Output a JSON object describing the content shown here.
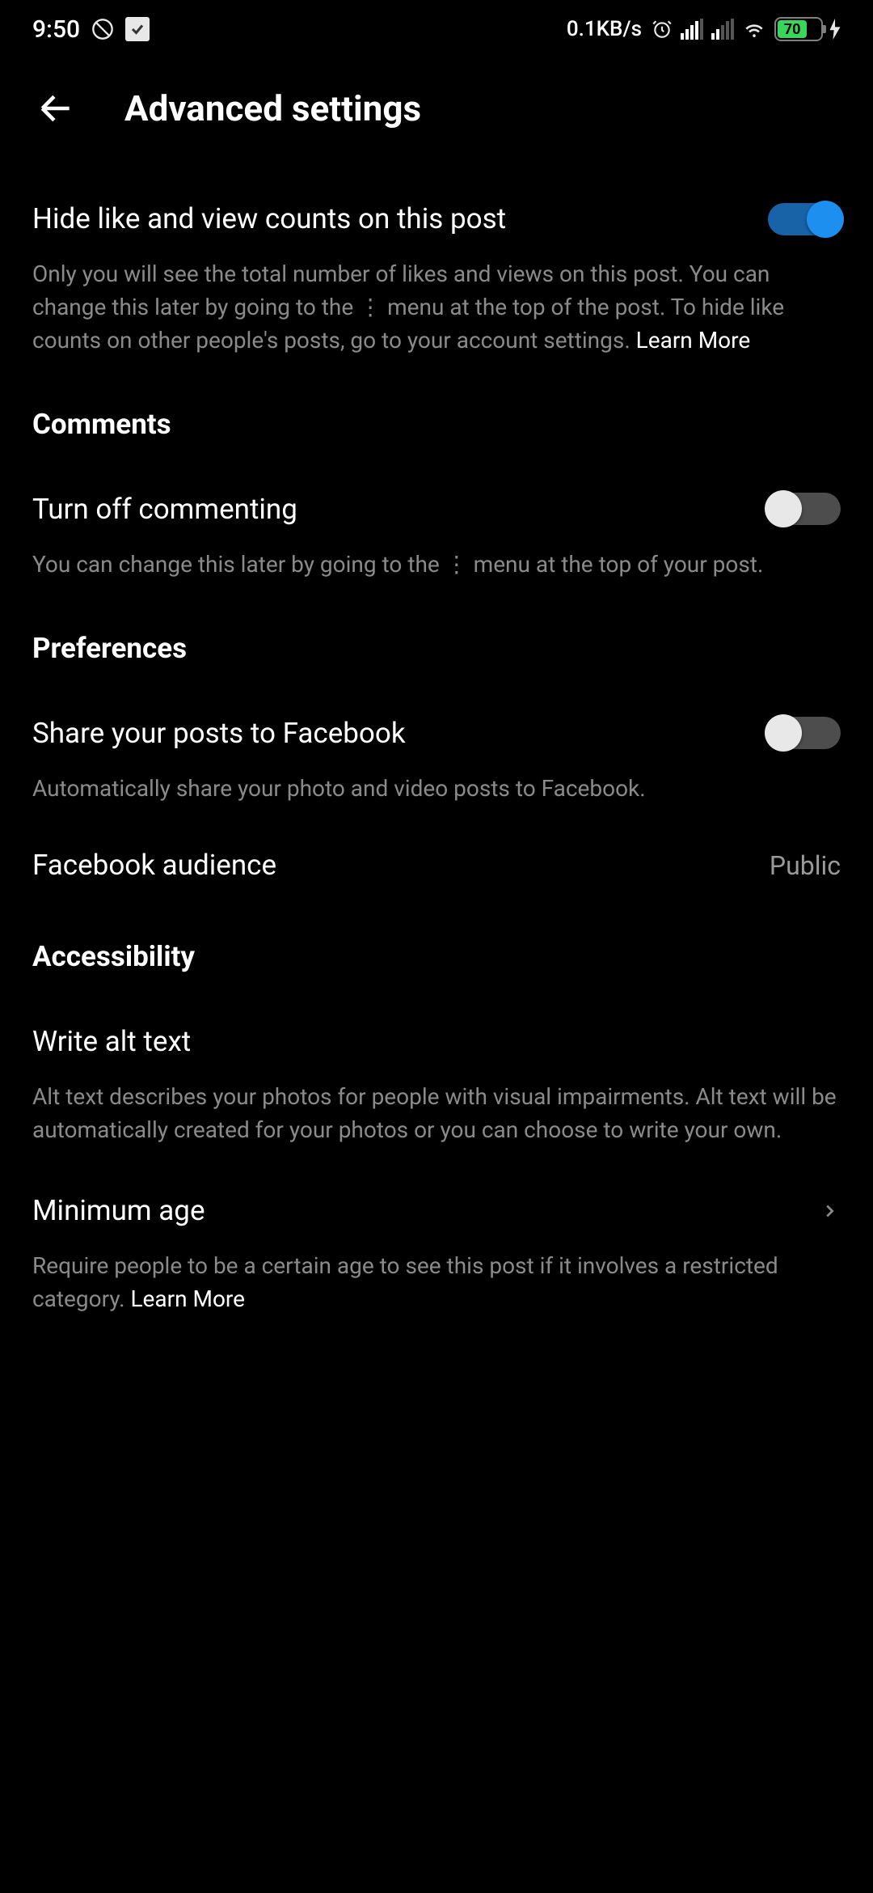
{
  "status": {
    "time": "9:50",
    "speed": "0.1KB/s",
    "battery_pct": "70",
    "battery_fill_width": "70%"
  },
  "header": {
    "title": "Advanced settings"
  },
  "hide_counts": {
    "title": "Hide like and view counts on this post",
    "desc": "Only you will see the total number of likes and views on this post. You can change this later by going to the ⋮ menu at the top of the post. To hide like counts on other people's posts, go to your account settings. ",
    "learn_more": "Learn More",
    "toggle_on": true
  },
  "sections": {
    "comments": "Comments",
    "preferences": "Preferences",
    "accessibility": "Accessibility"
  },
  "commenting": {
    "title": "Turn off commenting",
    "desc": "You can change this later by going to the  ⋮  menu at the top of your post.",
    "toggle_on": false
  },
  "share_fb": {
    "title": "Share your posts to Facebook",
    "desc": "Automatically share your photo and video posts to Facebook.",
    "toggle_on": false
  },
  "fb_audience": {
    "title": "Facebook audience",
    "value": "Public"
  },
  "alt_text": {
    "title": "Write alt text",
    "desc": "Alt text describes your photos for people with visual impairments. Alt text will be automatically created for your photos or you can choose to write your own."
  },
  "min_age": {
    "title": "Minimum age",
    "desc": "Require people to be a certain age to see this post if it involves a restricted category. ",
    "learn_more": "Learn More"
  }
}
